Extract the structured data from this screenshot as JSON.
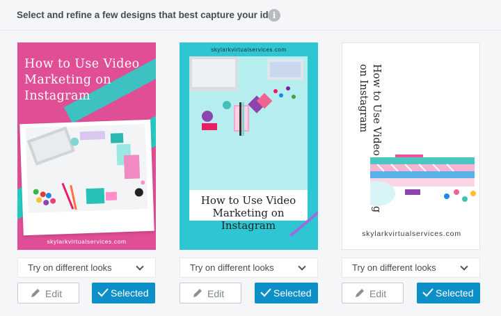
{
  "header": {
    "title": "Select and refine a few designs that best capture your idea",
    "info_icon": "info-icon",
    "info_glyph": "i"
  },
  "designs": [
    {
      "title": "How to Use Video Marketing on Instagram",
      "url": "skylarkvirtualservices.com",
      "accent": "#e04e96",
      "dropdown_label": "Try on different looks",
      "edit_label": "Edit",
      "selected_label": "Selected"
    },
    {
      "title": "How to Use Video Marketing on Instagram",
      "url": "skylarkvirtualservices.com",
      "accent": "#2fc6d4",
      "dropdown_label": "Try on different looks",
      "edit_label": "Edit",
      "selected_label": "Selected"
    },
    {
      "title": "How to Use Video Marketing on Instagram",
      "url": "skylarkvirtualservices.com",
      "accent": "#ffffff",
      "dropdown_label": "Try on different looks",
      "edit_label": "Edit",
      "selected_label": "Selected"
    }
  ],
  "colors": {
    "selected_button": "#0d90c8",
    "edit_border": "#c5cad0"
  },
  "icons": [
    "info-icon",
    "chevron-down-icon",
    "pencil-icon",
    "checkmark-icon"
  ]
}
